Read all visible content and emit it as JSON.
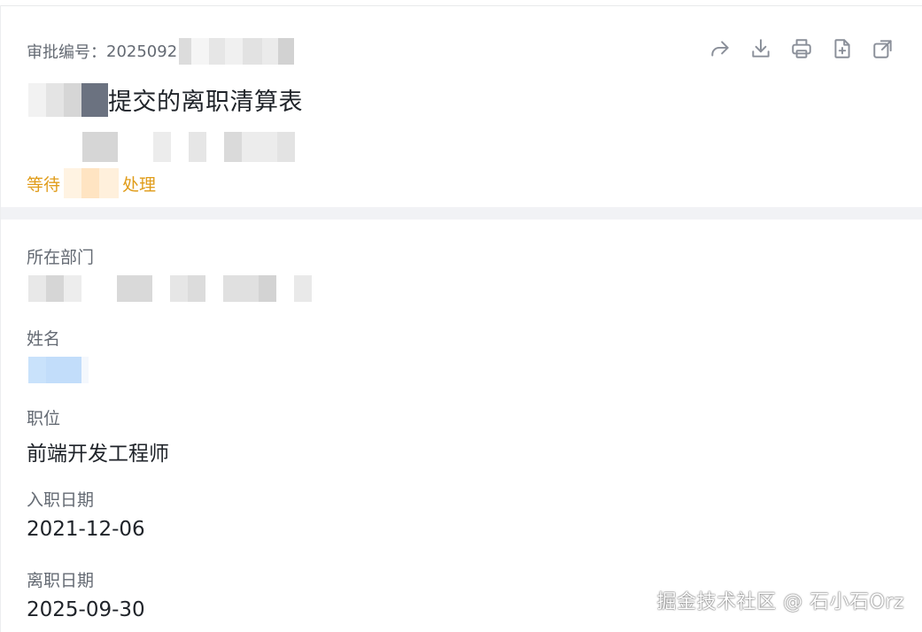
{
  "header": {
    "approval_no_label": "审批编号：",
    "approval_no_prefix": "2025092",
    "title_suffix": "提交的离职清算表",
    "status_prefix": "等待",
    "status_suffix": "处理"
  },
  "toolbar": {
    "icons": [
      "share-icon",
      "download-icon",
      "print-icon",
      "add-file-icon",
      "open-external-icon"
    ]
  },
  "fields": {
    "department": {
      "label": "所在部门",
      "value": ""
    },
    "name": {
      "label": "姓名",
      "value": ""
    },
    "position": {
      "label": "职位",
      "value": "前端开发工程师"
    },
    "hire_date": {
      "label": "入职日期",
      "value": "2021-12-06"
    },
    "leave_date": {
      "label": "离职日期",
      "value": "2025-09-30"
    }
  },
  "watermark": {
    "text": "掘金技术社区 @ 石小石Orz"
  },
  "colors": {
    "status": "#e09c1a",
    "label": "#646a73",
    "text": "#1f2329",
    "band": "#f1f2f5"
  }
}
